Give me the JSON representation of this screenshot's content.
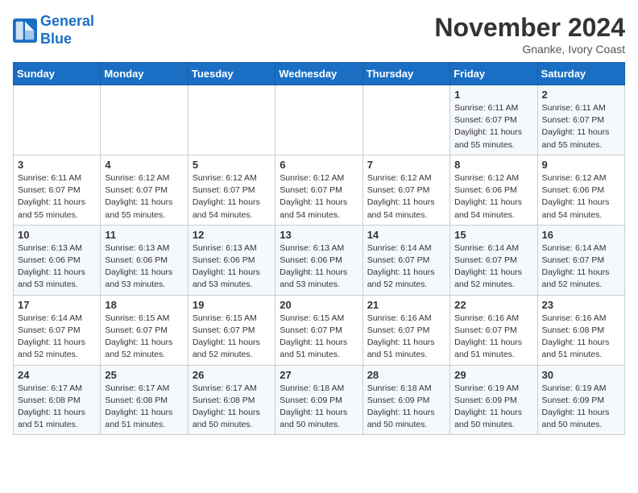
{
  "header": {
    "logo_line1": "General",
    "logo_line2": "Blue",
    "month_title": "November 2024",
    "subtitle": "Gnanke, Ivory Coast"
  },
  "days_of_week": [
    "Sunday",
    "Monday",
    "Tuesday",
    "Wednesday",
    "Thursday",
    "Friday",
    "Saturday"
  ],
  "weeks": [
    [
      {
        "day": "",
        "info": ""
      },
      {
        "day": "",
        "info": ""
      },
      {
        "day": "",
        "info": ""
      },
      {
        "day": "",
        "info": ""
      },
      {
        "day": "",
        "info": ""
      },
      {
        "day": "1",
        "info": "Sunrise: 6:11 AM\nSunset: 6:07 PM\nDaylight: 11 hours and 55 minutes."
      },
      {
        "day": "2",
        "info": "Sunrise: 6:11 AM\nSunset: 6:07 PM\nDaylight: 11 hours and 55 minutes."
      }
    ],
    [
      {
        "day": "3",
        "info": "Sunrise: 6:11 AM\nSunset: 6:07 PM\nDaylight: 11 hours and 55 minutes."
      },
      {
        "day": "4",
        "info": "Sunrise: 6:12 AM\nSunset: 6:07 PM\nDaylight: 11 hours and 55 minutes."
      },
      {
        "day": "5",
        "info": "Sunrise: 6:12 AM\nSunset: 6:07 PM\nDaylight: 11 hours and 54 minutes."
      },
      {
        "day": "6",
        "info": "Sunrise: 6:12 AM\nSunset: 6:07 PM\nDaylight: 11 hours and 54 minutes."
      },
      {
        "day": "7",
        "info": "Sunrise: 6:12 AM\nSunset: 6:07 PM\nDaylight: 11 hours and 54 minutes."
      },
      {
        "day": "8",
        "info": "Sunrise: 6:12 AM\nSunset: 6:06 PM\nDaylight: 11 hours and 54 minutes."
      },
      {
        "day": "9",
        "info": "Sunrise: 6:12 AM\nSunset: 6:06 PM\nDaylight: 11 hours and 54 minutes."
      }
    ],
    [
      {
        "day": "10",
        "info": "Sunrise: 6:13 AM\nSunset: 6:06 PM\nDaylight: 11 hours and 53 minutes."
      },
      {
        "day": "11",
        "info": "Sunrise: 6:13 AM\nSunset: 6:06 PM\nDaylight: 11 hours and 53 minutes."
      },
      {
        "day": "12",
        "info": "Sunrise: 6:13 AM\nSunset: 6:06 PM\nDaylight: 11 hours and 53 minutes."
      },
      {
        "day": "13",
        "info": "Sunrise: 6:13 AM\nSunset: 6:06 PM\nDaylight: 11 hours and 53 minutes."
      },
      {
        "day": "14",
        "info": "Sunrise: 6:14 AM\nSunset: 6:07 PM\nDaylight: 11 hours and 52 minutes."
      },
      {
        "day": "15",
        "info": "Sunrise: 6:14 AM\nSunset: 6:07 PM\nDaylight: 11 hours and 52 minutes."
      },
      {
        "day": "16",
        "info": "Sunrise: 6:14 AM\nSunset: 6:07 PM\nDaylight: 11 hours and 52 minutes."
      }
    ],
    [
      {
        "day": "17",
        "info": "Sunrise: 6:14 AM\nSunset: 6:07 PM\nDaylight: 11 hours and 52 minutes."
      },
      {
        "day": "18",
        "info": "Sunrise: 6:15 AM\nSunset: 6:07 PM\nDaylight: 11 hours and 52 minutes."
      },
      {
        "day": "19",
        "info": "Sunrise: 6:15 AM\nSunset: 6:07 PM\nDaylight: 11 hours and 52 minutes."
      },
      {
        "day": "20",
        "info": "Sunrise: 6:15 AM\nSunset: 6:07 PM\nDaylight: 11 hours and 51 minutes."
      },
      {
        "day": "21",
        "info": "Sunrise: 6:16 AM\nSunset: 6:07 PM\nDaylight: 11 hours and 51 minutes."
      },
      {
        "day": "22",
        "info": "Sunrise: 6:16 AM\nSunset: 6:07 PM\nDaylight: 11 hours and 51 minutes."
      },
      {
        "day": "23",
        "info": "Sunrise: 6:16 AM\nSunset: 6:08 PM\nDaylight: 11 hours and 51 minutes."
      }
    ],
    [
      {
        "day": "24",
        "info": "Sunrise: 6:17 AM\nSunset: 6:08 PM\nDaylight: 11 hours and 51 minutes."
      },
      {
        "day": "25",
        "info": "Sunrise: 6:17 AM\nSunset: 6:08 PM\nDaylight: 11 hours and 51 minutes."
      },
      {
        "day": "26",
        "info": "Sunrise: 6:17 AM\nSunset: 6:08 PM\nDaylight: 11 hours and 50 minutes."
      },
      {
        "day": "27",
        "info": "Sunrise: 6:18 AM\nSunset: 6:09 PM\nDaylight: 11 hours and 50 minutes."
      },
      {
        "day": "28",
        "info": "Sunrise: 6:18 AM\nSunset: 6:09 PM\nDaylight: 11 hours and 50 minutes."
      },
      {
        "day": "29",
        "info": "Sunrise: 6:19 AM\nSunset: 6:09 PM\nDaylight: 11 hours and 50 minutes."
      },
      {
        "day": "30",
        "info": "Sunrise: 6:19 AM\nSunset: 6:09 PM\nDaylight: 11 hours and 50 minutes."
      }
    ]
  ]
}
